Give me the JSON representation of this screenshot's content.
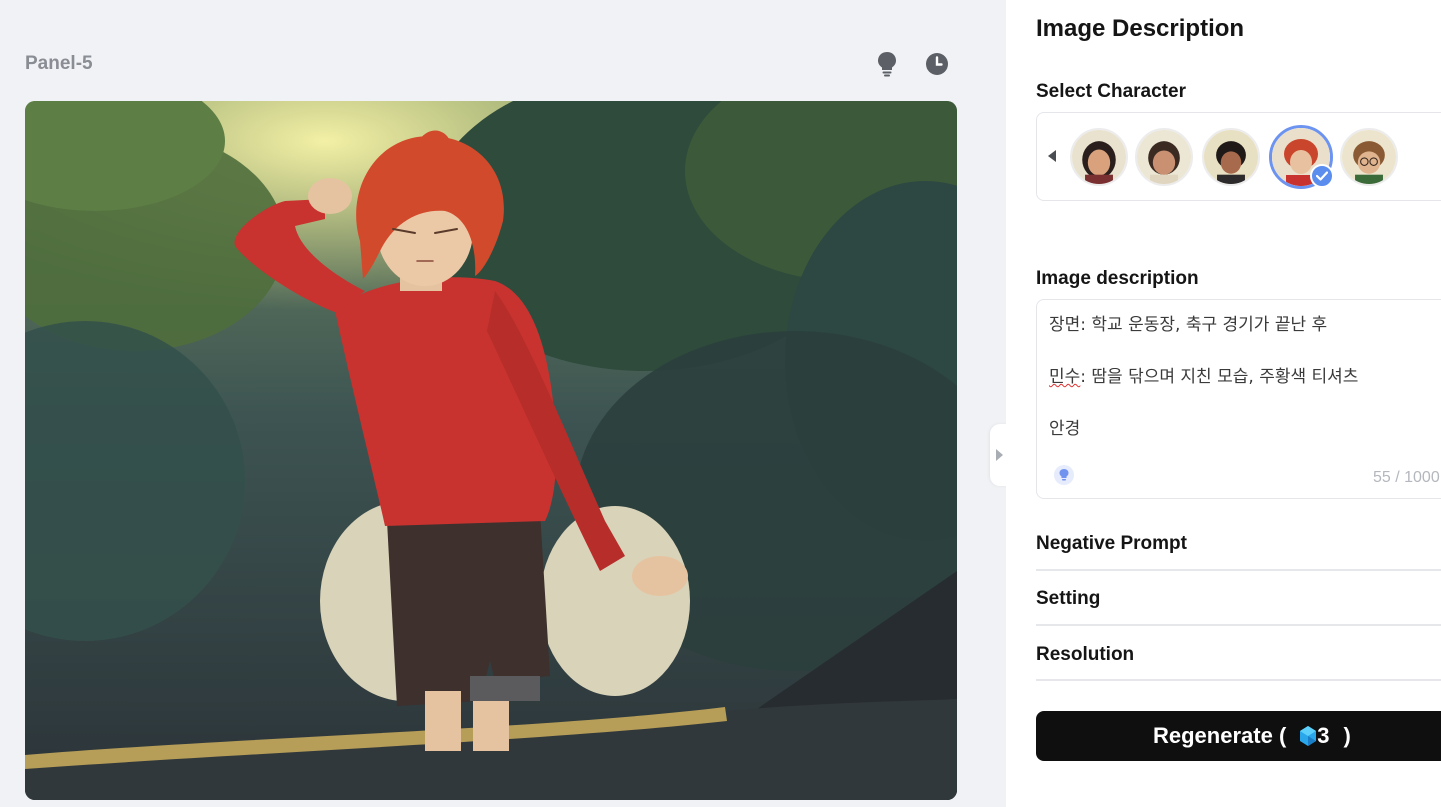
{
  "panel": {
    "title": "Panel-5"
  },
  "toolbar": {
    "icons": [
      "lightbulb-icon",
      "clock-history-icon"
    ]
  },
  "sidebar": {
    "title": "Image Description",
    "select_character": {
      "label": "Select Character",
      "characters": [
        {
          "name": "character-1",
          "selected": false
        },
        {
          "name": "character-2",
          "selected": false
        },
        {
          "name": "character-3",
          "selected": false
        },
        {
          "name": "character-4",
          "selected": true
        },
        {
          "name": "character-5",
          "selected": false
        }
      ]
    },
    "image_description": {
      "label": "Image description",
      "line1": "장면: 학교 운동장, 축구 경기가 끝난 후",
      "line2_name": "민수",
      "line2_rest": ": 땀을 닦으며 지친 모습, 주황색 티셔츠",
      "line3": "안경",
      "char_count": "55 / 1000"
    },
    "negative_prompt": {
      "label": "Negative Prompt"
    },
    "setting": {
      "label": "Setting"
    },
    "resolution": {
      "label": "Resolution"
    },
    "regenerate": {
      "label": "Regenerate (",
      "cost": "3",
      "close": ")"
    }
  },
  "colors": {
    "accent": "#5b8def",
    "button_bg": "#0f0f0f",
    "canvas_bg": "#f0f2f5",
    "shirt": "#c8332f",
    "hair": "#d24a2c"
  }
}
